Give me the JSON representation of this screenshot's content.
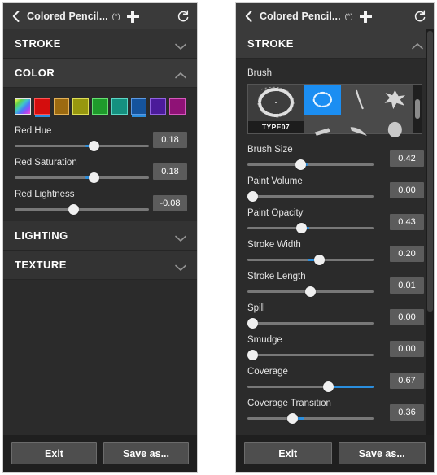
{
  "theme": {
    "panel_bg": "#2b2b2b",
    "section_bg": "#333333",
    "accent": "#2a8ede",
    "selected_brush": "#1b8ef2",
    "value_box_bg": "#5c5c5c",
    "footer_bg": "#1f1f1f"
  },
  "titlebar": {
    "back_icon": "chevron-left-icon",
    "title": "Colored Pencil...",
    "modified_marker": "(*)",
    "add_icon": "plus-icon",
    "refresh_icon": "refresh-icon"
  },
  "footer": {
    "exit_label": "Exit",
    "save_label": "Save as..."
  },
  "left_panel": {
    "sections": [
      {
        "label": "STROKE",
        "expanded": false,
        "chevron": "chevron-down-icon"
      },
      {
        "label": "COLOR",
        "expanded": true,
        "chevron": "chevron-up-icon"
      },
      {
        "label": "LIGHTING",
        "expanded": false,
        "chevron": "chevron-down-icon"
      },
      {
        "label": "TEXTURE",
        "expanded": false,
        "chevron": "chevron-down-icon"
      }
    ],
    "color_swatches": [
      {
        "name": "rainbow-swatch",
        "color": "rainbow",
        "selected": false
      },
      {
        "name": "red-swatch",
        "color": "#d40d0d",
        "selected": true
      },
      {
        "name": "orange-swatch",
        "color": "#9c6a10",
        "selected": false
      },
      {
        "name": "yellow-swatch",
        "color": "#97970f",
        "selected": false
      },
      {
        "name": "green-swatch",
        "color": "#1f9a2b",
        "selected": false
      },
      {
        "name": "teal-swatch",
        "color": "#15907f",
        "selected": false
      },
      {
        "name": "blue-swatch",
        "color": "#15539c",
        "selected": true
      },
      {
        "name": "purple-swatch",
        "color": "#4b1b9a",
        "selected": false
      },
      {
        "name": "magenta-swatch",
        "color": "#8f1276",
        "selected": false
      }
    ],
    "sliders": [
      {
        "label": "Red Hue",
        "value": "0.18",
        "pos": 0.59,
        "fill": "left",
        "fill_amount": 0.06
      },
      {
        "label": "Red Saturation",
        "value": "0.18",
        "pos": 0.59,
        "fill": "left",
        "fill_amount": 0.06
      },
      {
        "label": "Red Lightness",
        "value": "-0.08",
        "pos": 0.44,
        "fill": "none",
        "fill_amount": 0
      }
    ]
  },
  "right_panel": {
    "section": {
      "label": "STROKE",
      "expanded": true,
      "chevron": "chevron-up-icon"
    },
    "brush": {
      "label": "Brush",
      "selected_name": "TYPE07",
      "preview_icon": "brush-ring-preview-icon",
      "thumbnails": [
        {
          "name": "brush-thumb-ring",
          "selected": true
        },
        {
          "name": "brush-thumb-stroke",
          "selected": false
        },
        {
          "name": "brush-thumb-splatter",
          "selected": false
        },
        {
          "name": "brush-thumb-flat",
          "selected": false
        },
        {
          "name": "brush-thumb-curve",
          "selected": false
        },
        {
          "name": "brush-thumb-blob",
          "selected": false
        }
      ],
      "scrollbar": "brush-grid-scrollbar"
    },
    "sliders": [
      {
        "label": "Brush Size",
        "value": "0.42",
        "pos": 0.42,
        "fill": "right",
        "fill_amount": 0.06
      },
      {
        "label": "Paint Volume",
        "value": "0.00",
        "pos": 0.04,
        "fill": "none",
        "fill_amount": 0
      },
      {
        "label": "Paint Opacity",
        "value": "0.43",
        "pos": 0.43,
        "fill": "right",
        "fill_amount": 0.06
      },
      {
        "label": "Stroke Width",
        "value": "0.20",
        "pos": 0.57,
        "fill": "left",
        "fill_amount": 0.09
      },
      {
        "label": "Stroke Length",
        "value": "0.01",
        "pos": 0.5,
        "fill": "none",
        "fill_amount": 0
      },
      {
        "label": "Spill",
        "value": "0.00",
        "pos": 0.04,
        "fill": "none",
        "fill_amount": 0
      },
      {
        "label": "Smudge",
        "value": "0.00",
        "pos": 0.04,
        "fill": "none",
        "fill_amount": 0
      },
      {
        "label": "Coverage",
        "value": "0.67",
        "pos": 0.64,
        "fill": "right",
        "fill_amount": 0.36
      },
      {
        "label": "Coverage Transition",
        "value": "0.36",
        "pos": 0.36,
        "fill": "right",
        "fill_amount": 0.09
      }
    ],
    "scrollbar": "stroke-panel-scrollbar"
  }
}
